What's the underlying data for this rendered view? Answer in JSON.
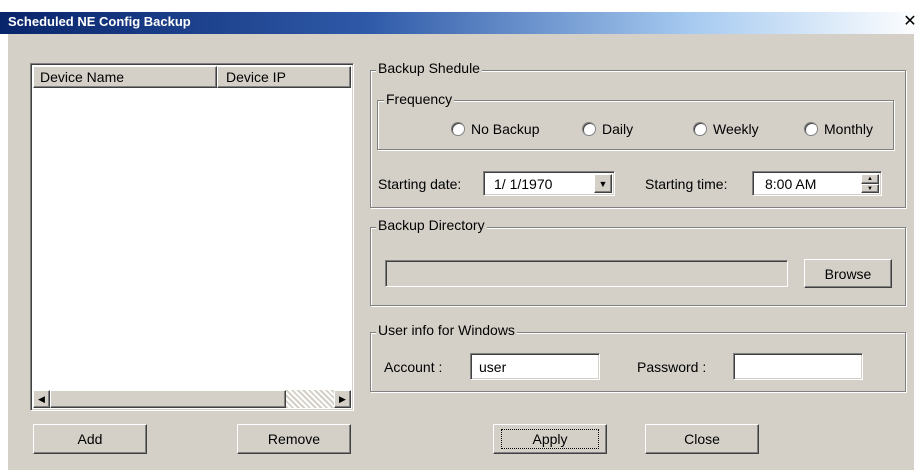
{
  "window": {
    "title": "Scheduled NE Config Backup",
    "close_glyph": "✕"
  },
  "device_list": {
    "columns": [
      "Device Name",
      "Device IP"
    ],
    "rows": []
  },
  "left_buttons": {
    "add": "Add",
    "remove": "Remove"
  },
  "schedule": {
    "group_title": "Backup Shedule",
    "frequency": {
      "group_title": "Frequency",
      "options": [
        "No Backup",
        "Daily",
        "Weekly",
        "Monthly"
      ]
    },
    "starting_date_label": "Starting date:",
    "starting_date_value": "1/ 1/1970",
    "starting_time_label": "Starting time:",
    "starting_time_value": "8:00 AM"
  },
  "directory": {
    "group_title": "Backup Directory",
    "path": "",
    "browse": "Browse"
  },
  "user_info": {
    "group_title": "User info for Windows",
    "account_label": "Account :",
    "account_value": "user",
    "password_label": "Password :",
    "password_value": ""
  },
  "bottom_buttons": {
    "apply": "Apply",
    "close": "Close"
  }
}
